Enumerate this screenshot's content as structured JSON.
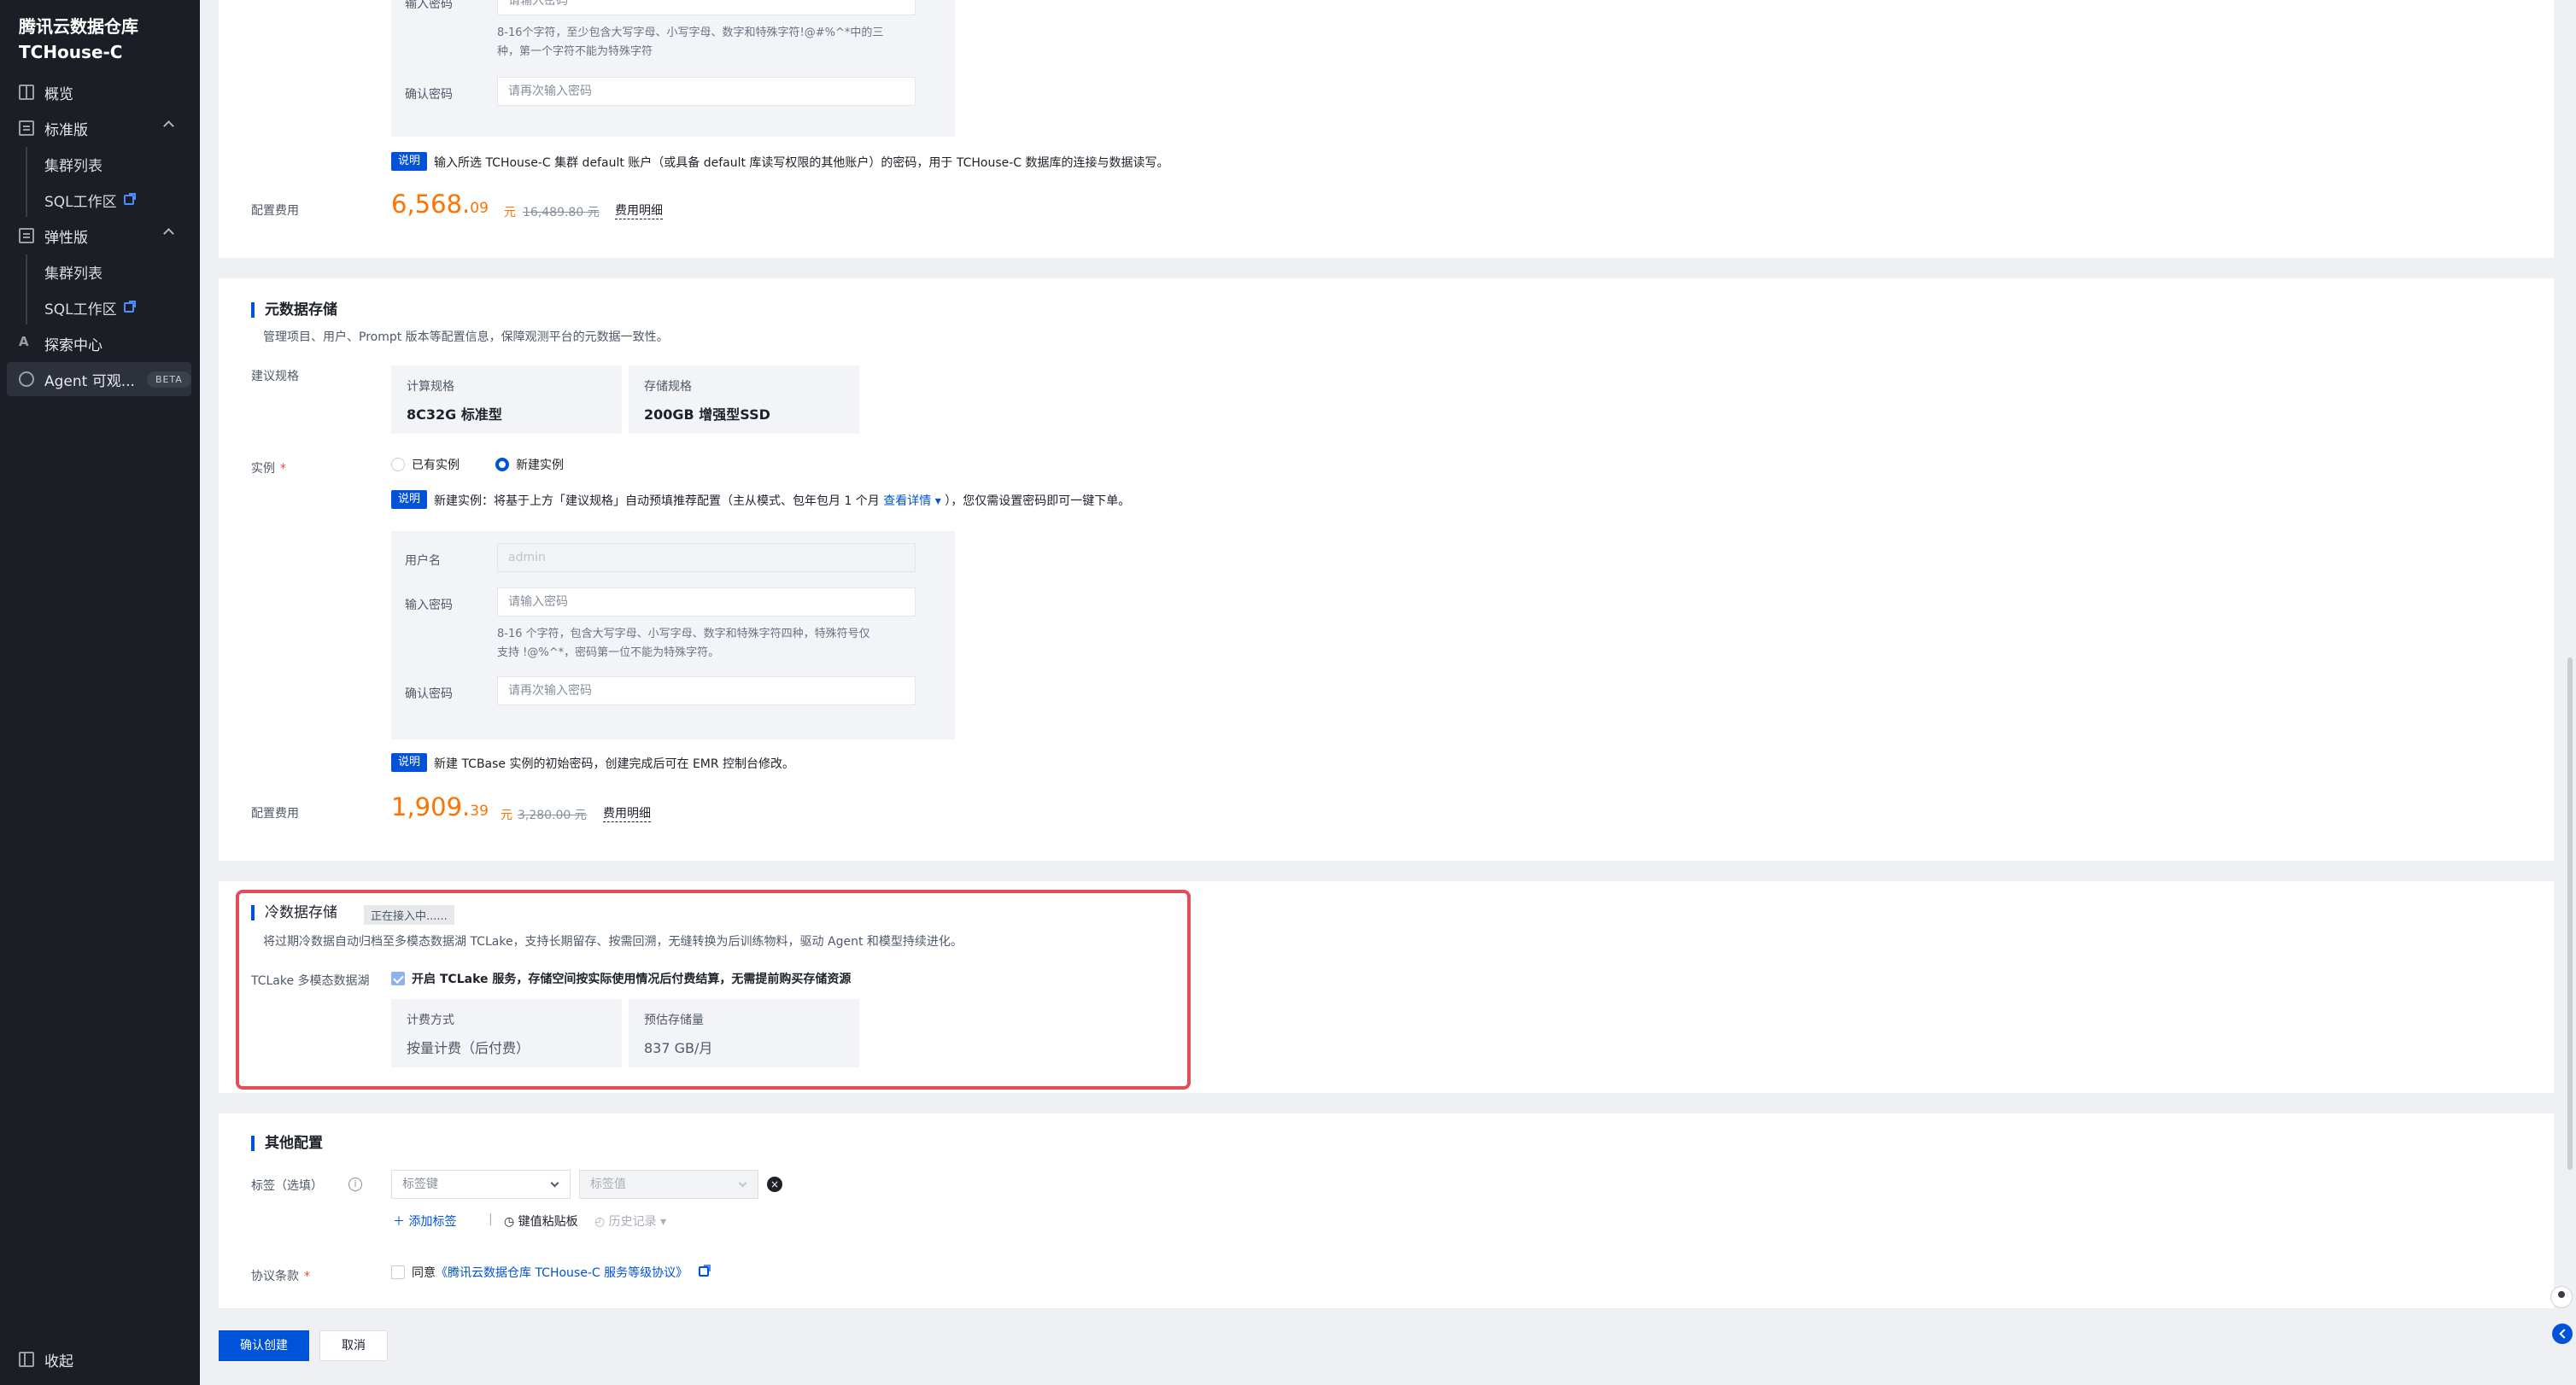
{
  "sidebar": {
    "brand_line1": "腾讯云数据仓库",
    "brand_line2": "TCHouse-C",
    "overview": "概览",
    "standard": "标准版",
    "standard_clusters": "集群列表",
    "standard_sql": "SQL工作区",
    "elastic": "弹性版",
    "elastic_clusters": "集群列表",
    "elastic_sql": "SQL工作区",
    "explore": "探索中心",
    "agent": "Agent 可观...",
    "agent_badge": "BETA",
    "collapse": "收起"
  },
  "top_section": {
    "password_label_cut": "输入密码",
    "password_placeholder_cut": "请输入密码",
    "password_hint_line1": "8-16个字符，至少包含大写字母、小写字母、数字和特殊字符!@#%^*中的三",
    "password_hint_line2": "种，第一个字符不能为特殊字符",
    "confirm_label": "确认密码",
    "confirm_placeholder": "请再次输入密码",
    "note_tag": "说明",
    "note_text": "输入所选 TCHouse-C 集群 default 账户（或具备 default 库读写权限的其他账户）的密码，用于 TCHouse-C 数据库的连接与数据读写。",
    "fee_label": "配置费用",
    "price_int": "6,568.",
    "price_dec": "09",
    "price_unit": "元",
    "price_orig": "16,489.80 元",
    "fee_link": "费用明细"
  },
  "metadata": {
    "title": "元数据存储",
    "desc": "管理项目、用户、Prompt 版本等配置信息，保障观测平台的元数据一致性。",
    "spec_label": "建议规格",
    "compute_k": "计算规格",
    "compute_v": "8C32G 标准型",
    "storage_k": "存储规格",
    "storage_v": "200GB 增强型SSD",
    "instance_label": "实例",
    "existing": "已有实例",
    "new_instance": "新建实例",
    "note_tag": "说明",
    "note_text_a": "新建实例：将基于上方「建议规格」自动预填推荐配置（主从模式、包年包月 1 个月",
    "note_link": "查看详情",
    "note_text_b": "），您仅需设置密码即可一键下单。",
    "username_label": "用户名",
    "username_value": "admin",
    "password_label": "输入密码",
    "password_placeholder": "请输入密码",
    "hint_line1": "8-16 个字符，包含大写字母、小写字母、数字和特殊字符四种，特殊符号仅",
    "hint_line2": "支持 !@%^*，密码第一位不能为特殊字符。",
    "confirm_label": "确认密码",
    "confirm_placeholder": "请再次输入密码",
    "note2_tag": "说明",
    "note2_text": "新建 TCBase 实例的初始密码，创建完成后可在 EMR 控制台修改。",
    "fee_label": "配置费用",
    "price_int": "1,909.",
    "price_dec": "39",
    "price_unit": "元",
    "price_orig": "3,280.00 元",
    "fee_link": "费用明细"
  },
  "cold": {
    "title": "冷数据存储",
    "status": "正在接入中......",
    "desc": "将过期冷数据自动归档至多模态数据湖 TCLake，支持长期留存、按需回溯，无缝转换为后训练物料，驱动 Agent 和模型持续进化。",
    "lake_label": "TCLake 多模态数据湖",
    "checkbox_text": "开启 TCLake 服务，存储空间按实际使用情况后付费结算，无需提前购买存储资源",
    "billing_k": "计费方式",
    "billing_v": "按量计费（后付费）",
    "est_k": "预估存储量",
    "est_v": "837 GB/月"
  },
  "other": {
    "title": "其他配置",
    "tag_label": "标签（选填）",
    "tag_key_placeholder": "标签键",
    "tag_value_placeholder": "标签值",
    "add_tag": "添加标签",
    "paste_board": "键值粘贴板",
    "history": "历史记录",
    "agreement_label": "协议条款",
    "agree_prefix": "同意",
    "agreement_link": "《腾讯云数据仓库 TCHouse-C 服务等级协议》"
  },
  "footer": {
    "confirm": "确认创建",
    "cancel": "取消"
  },
  "colors": {
    "primary": "#0052d9",
    "price": "#ff7200",
    "highlight_frame": "#e34d59",
    "sidebar_bg": "#1b1e25"
  }
}
